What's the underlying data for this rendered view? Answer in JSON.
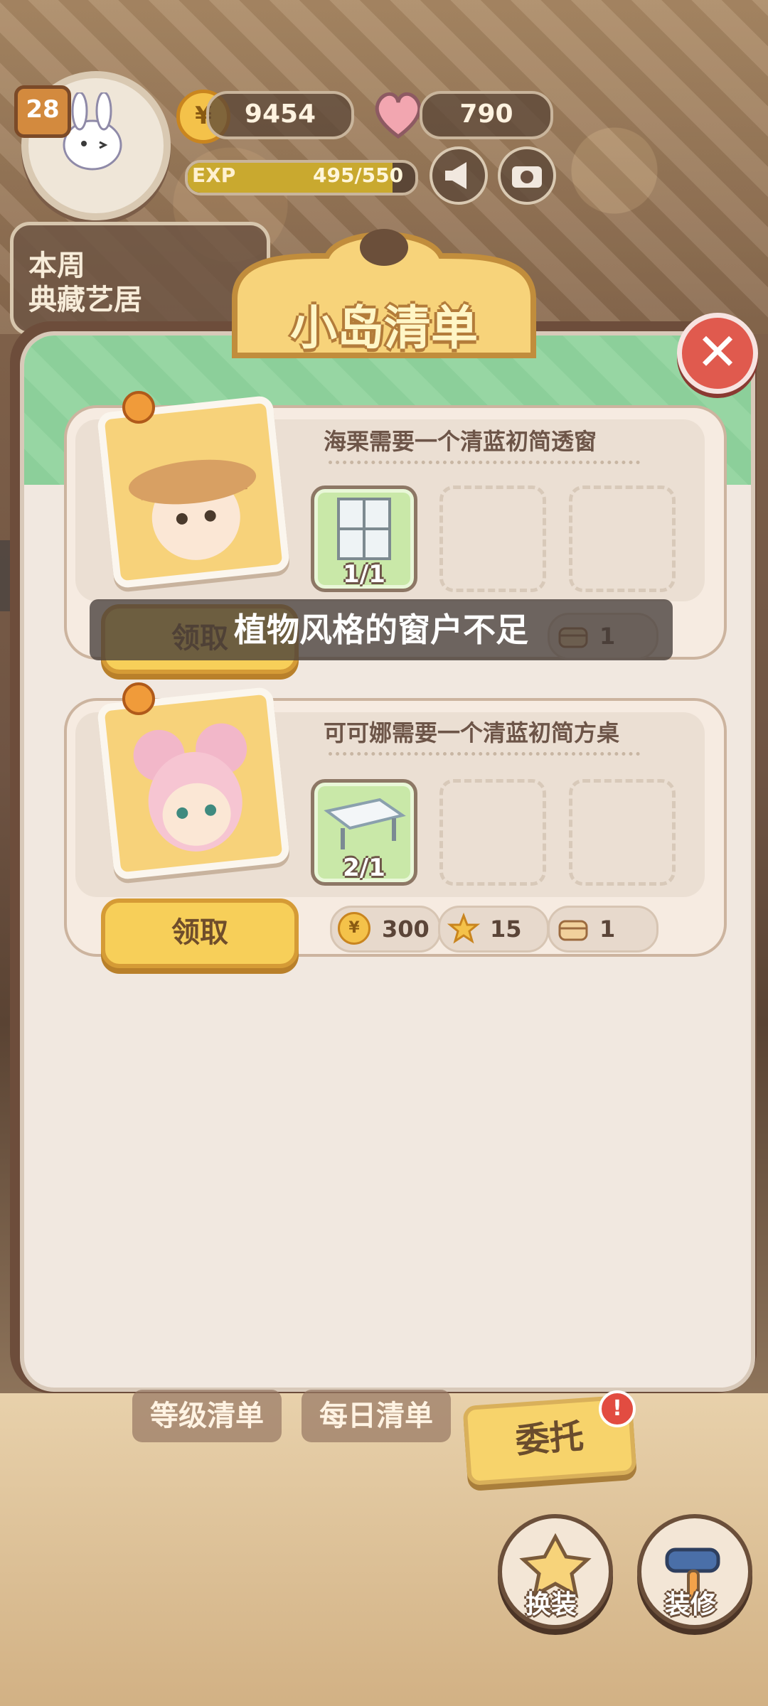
{
  "hud": {
    "level": "28",
    "coins": "9454",
    "hearts": "790",
    "exp_label": "EXP",
    "exp_value": "495/550",
    "exp_progress": 0.9,
    "weekly_label_line1": "本周",
    "weekly_label_line2": "典藏艺居"
  },
  "dialog": {
    "title": "小岛清单",
    "close_symbol": "✕"
  },
  "tasks": [
    {
      "title": "海栗需要一个清蓝初简透窗",
      "slot_count": "1/1",
      "claim_label": "领取",
      "rewards": [
        {
          "icon": "box-icon",
          "value": "1"
        }
      ]
    },
    {
      "title": "可可娜需要一个清蓝初简方桌",
      "slot_count": "2/1",
      "claim_label": "领取",
      "rewards": [
        {
          "icon": "coin-icon",
          "value": "300"
        },
        {
          "icon": "star-icon",
          "value": "15"
        },
        {
          "icon": "box-icon",
          "value": "1"
        }
      ]
    }
  ],
  "toast": {
    "message": "植物风格的窗户不足"
  },
  "tabs": {
    "level_list": "等级清单",
    "daily_list": "每日清单",
    "entrust": "委托",
    "entrust_alert": "!"
  },
  "bottom": {
    "outfit": "换装",
    "decorate": "装修"
  },
  "colors": {
    "accent_green": "#8ccf9a",
    "button_yellow": "#f7cf59",
    "close_red": "#e05a4e"
  }
}
